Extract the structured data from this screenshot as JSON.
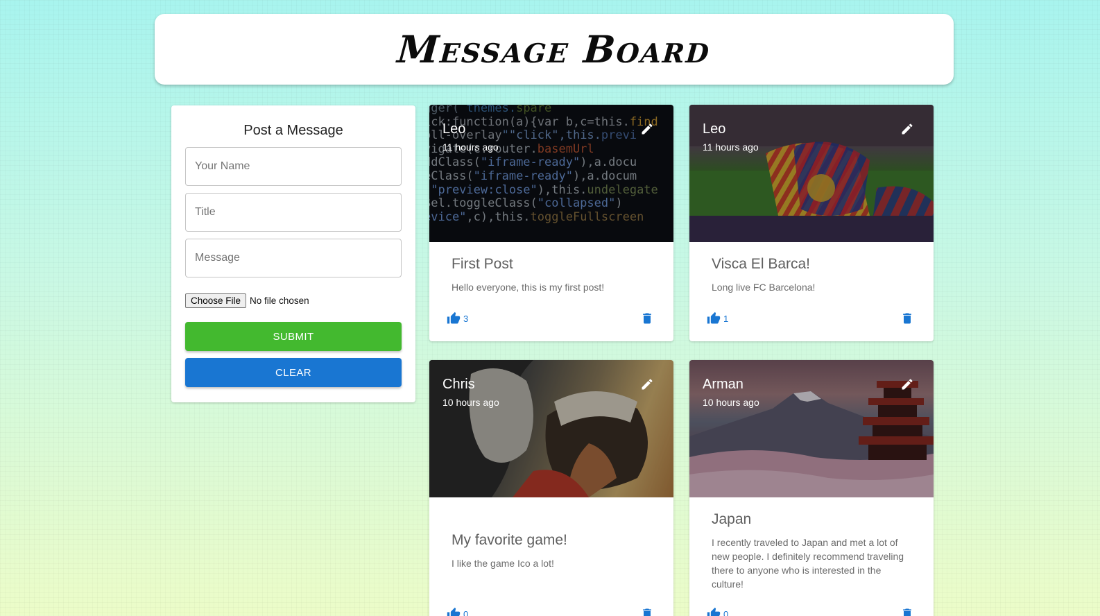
{
  "header": {
    "title": "Message Board"
  },
  "form": {
    "title": "Post a Message",
    "name_placeholder": "Your Name",
    "title_placeholder": "Title",
    "message_placeholder": "Message",
    "file_button": "Choose File",
    "file_status": "No file chosen",
    "submit_label": "SUBMIT",
    "clear_label": "CLEAR"
  },
  "colors": {
    "submit": "#43b92f",
    "clear": "#1976d2",
    "accent": "#1976d2"
  },
  "posts": [
    {
      "author": "Leo",
      "time": "11 hours ago",
      "title": "First Post",
      "message": "Hello everyone, this is my first post!",
      "likes": "3",
      "image": "code-screen"
    },
    {
      "author": "Leo",
      "time": "11 hours ago",
      "title": "Visca El Barca!",
      "message": "Long live FC Barcelona!",
      "likes": "1",
      "image": "barca-stadium-flags"
    },
    {
      "author": "Chris",
      "time": "10 hours ago",
      "title": "My favorite game!",
      "message": "I like the game Ico a lot!",
      "likes": "0",
      "image": "ico-game-art"
    },
    {
      "author": "Arman",
      "time": "10 hours ago",
      "title": "Japan",
      "message": "I recently traveled to Japan and met a lot of new people. I definitely recommend traveling there to anyone who is interested in the culture!",
      "likes": "0",
      "image": "mount-fuji-pagoda"
    }
  ]
}
